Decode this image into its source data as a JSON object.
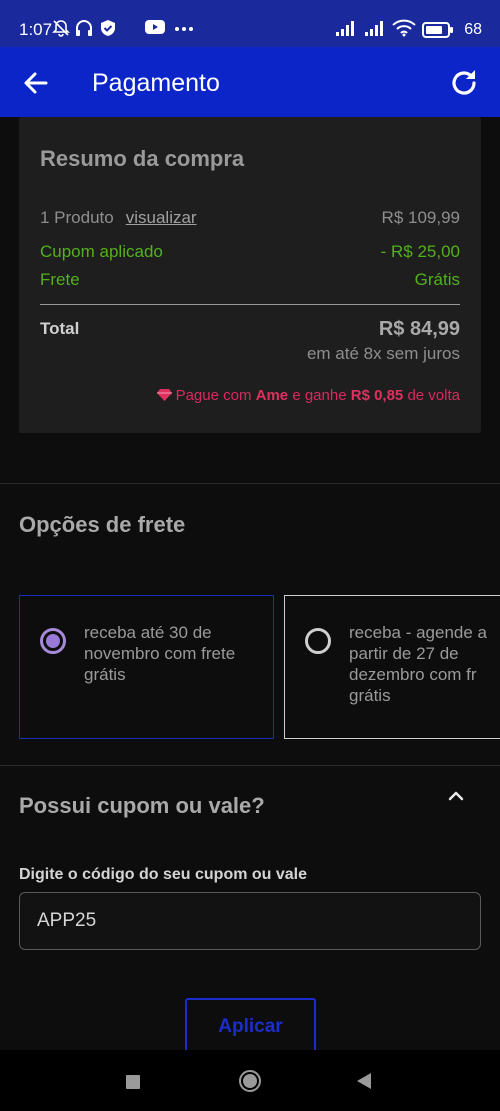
{
  "status_bar": {
    "time": "1:07",
    "battery": "68",
    "icons": [
      "mute-bell-icon",
      "headset-icon",
      "shield-icon",
      "youtube-icon",
      "more-dots-icon",
      "signal-icon",
      "signal-icon",
      "wifi-icon",
      "battery-icon"
    ]
  },
  "app_bar": {
    "title": "Pagamento",
    "back_icon": "arrow-left-icon",
    "refresh_icon": "refresh-icon"
  },
  "summary": {
    "title": "Resumo da compra",
    "product_label": "1 Produto",
    "view_link": "visualizar",
    "product_price": "R$ 109,99",
    "coupon_label": "Cupom aplicado",
    "coupon_value": "- R$ 25,00",
    "shipping_label": "Frete",
    "shipping_value": "Grátis",
    "total_label": "Total",
    "total_value": "R$ 84,99",
    "installments": "em até 8x sem juros",
    "ame_prefix": "Pague com",
    "ame_brand": "Ame",
    "ame_middle": "e ganhe",
    "ame_cashback": "R$ 0,85",
    "ame_suffix": "de volta"
  },
  "shipping": {
    "title": "Opções de frete",
    "options": [
      {
        "text": "receba até 30 de\nnovembro com frete\ngrátis",
        "selected": true
      },
      {
        "text": "receba - agende a\npartir de 27 de\ndezembro com fr\ngrátis",
        "selected": false
      }
    ]
  },
  "coupon": {
    "title": "Possui cupom ou vale?",
    "field_label": "Digite o código do seu cupom ou vale",
    "value": "APP25",
    "apply_label": "Aplicar"
  },
  "colors": {
    "status_bar": "#1a2a9c",
    "app_bar": "#0b25c9",
    "accent": "#1b2dcc",
    "green": "#53b11c",
    "ame_pink": "#d92a5f"
  }
}
